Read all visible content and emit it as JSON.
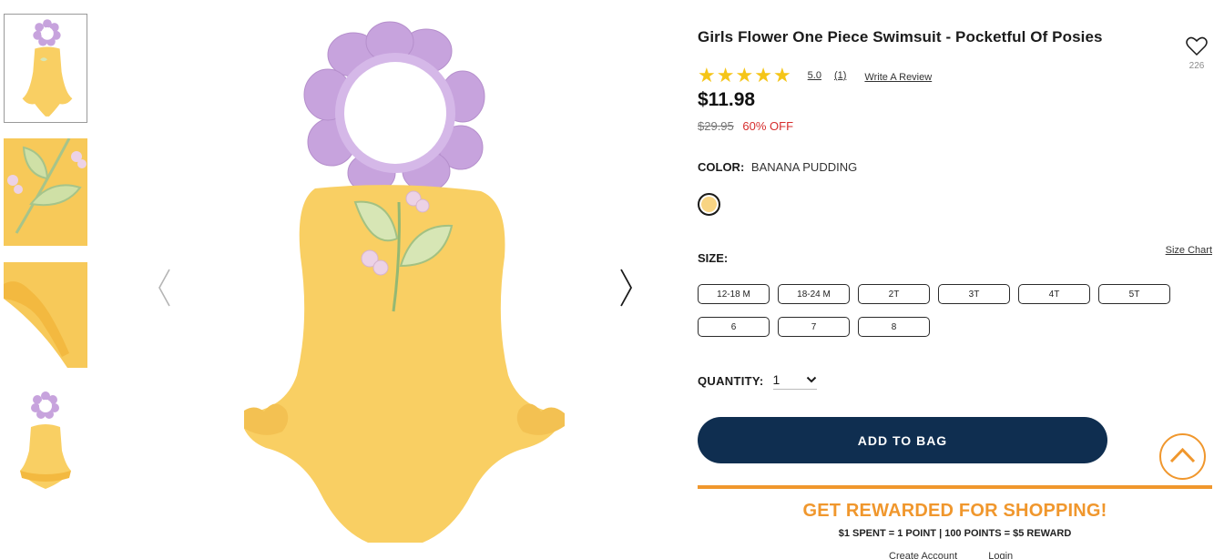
{
  "thumbnails": [
    {
      "name": "front-view",
      "selected": true
    },
    {
      "name": "flower-detail",
      "selected": false
    },
    {
      "name": "ruffle-detail",
      "selected": false
    },
    {
      "name": "back-view",
      "selected": false
    }
  ],
  "gallery": {
    "prev_icon": "chevron-left-icon",
    "next_icon": "chevron-right-icon"
  },
  "product": {
    "title": "Girls Flower One Piece Swimsuit - Pocketful Of Posies",
    "favorites_count": "226",
    "rating_value": "5.0",
    "rating_count": "(1)",
    "stars": 5,
    "write_review": "Write A Review",
    "price": "$11.98",
    "original_price": "$29.95",
    "discount": "60% OFF"
  },
  "color": {
    "label": "COLOR:",
    "value": "BANANA PUDDING",
    "swatch_hex": "#f8d483"
  },
  "size": {
    "label": "SIZE:",
    "chart_link": "Size Chart",
    "options": [
      "12-18 M",
      "18-24 M",
      "2T",
      "3T",
      "4T",
      "5T",
      "6",
      "7",
      "8"
    ]
  },
  "quantity": {
    "label": "QUANTITY:",
    "value": "1"
  },
  "cart": {
    "add_label": "ADD TO BAG"
  },
  "rewards": {
    "title": "GET REWARDED FOR SHOPPING!",
    "subtitle": "$1 SPENT = 1 POINT | 100 POINTS = $5 REWARD",
    "create_account": "Create Account",
    "login": "Login"
  },
  "colors": {
    "navy": "#0f2e50",
    "orange": "#f0972d",
    "star": "#f5c518",
    "sale": "#d62d2d",
    "swimsuit": "#f9cf63",
    "petal": "#c7a3dd"
  }
}
